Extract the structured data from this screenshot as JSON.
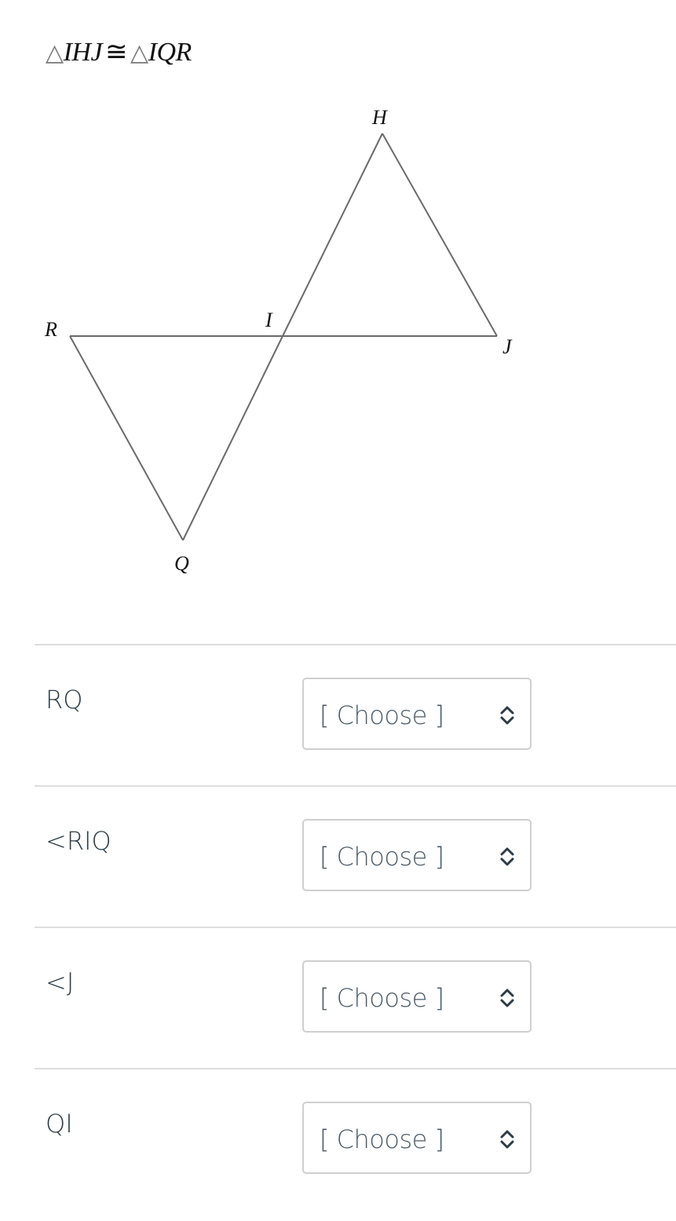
{
  "statement": {
    "triangle_symbol": "△",
    "left_triangle": "IHJ",
    "congruent_symbol": "≅",
    "right_triangle": "IQR"
  },
  "diagram": {
    "vertices": {
      "H": "H",
      "R": "R",
      "I": "I",
      "J": "J",
      "Q": "Q"
    },
    "segments": [
      "HJ",
      "HI",
      "IQ",
      "QR",
      "RJ"
    ]
  },
  "rows": [
    {
      "label": "RQ",
      "select": {
        "value": "[ Choose ]",
        "icon": "up-down-chevron-icon"
      }
    },
    {
      "label": "<RIQ",
      "select": {
        "value": "[ Choose ]",
        "icon": "up-down-chevron-icon"
      }
    },
    {
      "label": "<J",
      "select": {
        "value": "[ Choose ]",
        "icon": "up-down-chevron-icon"
      }
    },
    {
      "label": "QI",
      "select": {
        "value": "[ Choose ]",
        "icon": "up-down-chevron-icon"
      }
    }
  ]
}
